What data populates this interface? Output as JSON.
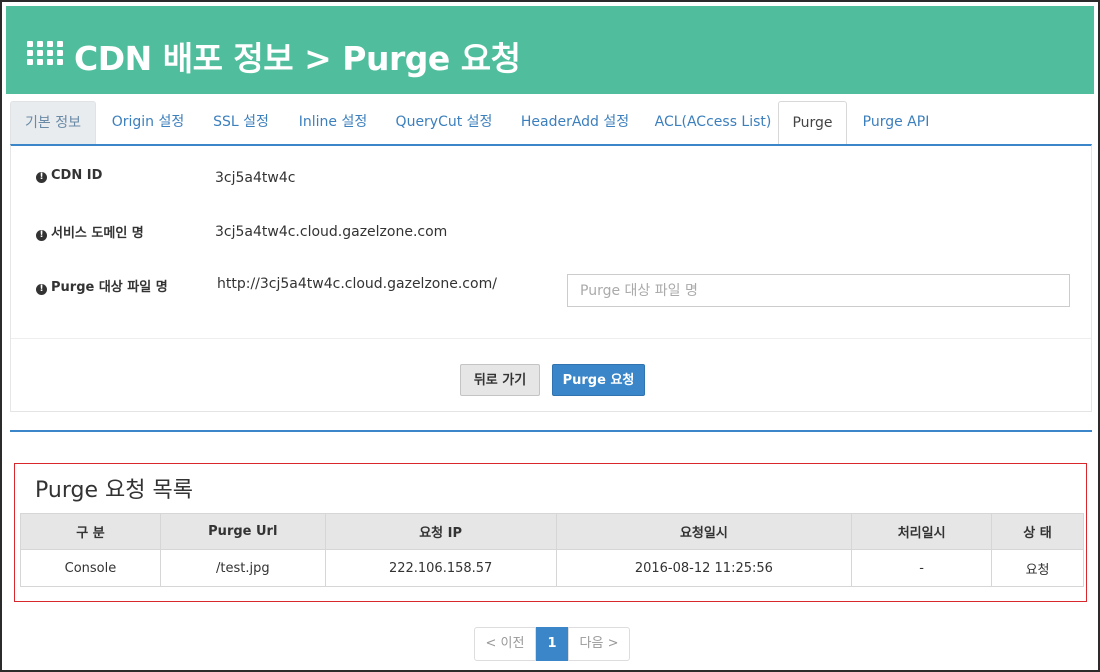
{
  "header": {
    "icon": "grid-icon",
    "title": "CDN 배포 정보 > Purge 요청"
  },
  "tabs": [
    {
      "label": "기본 정보"
    },
    {
      "label": "Origin 설정"
    },
    {
      "label": "SSL 설정"
    },
    {
      "label": "Inline 설정"
    },
    {
      "label": "QueryCut 설정"
    },
    {
      "label": "HeaderAdd 설정"
    },
    {
      "label": "ACL(ACcess List)"
    },
    {
      "label": "Purge"
    },
    {
      "label": "Purge API"
    }
  ],
  "info": {
    "cdn_id_label": "CDN ID",
    "cdn_id_value": "3cj5a4tw4c",
    "domain_label": "서비스 도메인 명",
    "domain_value": "3cj5a4tw4c.cloud.gazelzone.com",
    "purge_label": "Purge 대상 파일 명",
    "purge_prefix": "http://3cj5a4tw4c.cloud.gazelzone.com/",
    "purge_input_value": "",
    "purge_input_placeholder": "Purge 대상 파일 명"
  },
  "buttons": {
    "back": "뒤로 가기",
    "purge": "Purge 요청"
  },
  "list": {
    "title": "Purge 요청 목록",
    "columns": [
      "구 분",
      "Purge Url",
      "요청 IP",
      "요청일시",
      "처리일시",
      "상 태"
    ],
    "rows": [
      [
        "Console",
        "/test.jpg",
        "222.106.158.57",
        "2016-08-12 11:25:56",
        "-",
        "요청"
      ]
    ]
  },
  "pagination": {
    "prev": "< 이전",
    "current": "1",
    "next": "다음 >"
  },
  "colors": {
    "header_bg": "#50be9c",
    "accent_blue": "#3a86c8",
    "highlight_border": "#d9272e"
  }
}
